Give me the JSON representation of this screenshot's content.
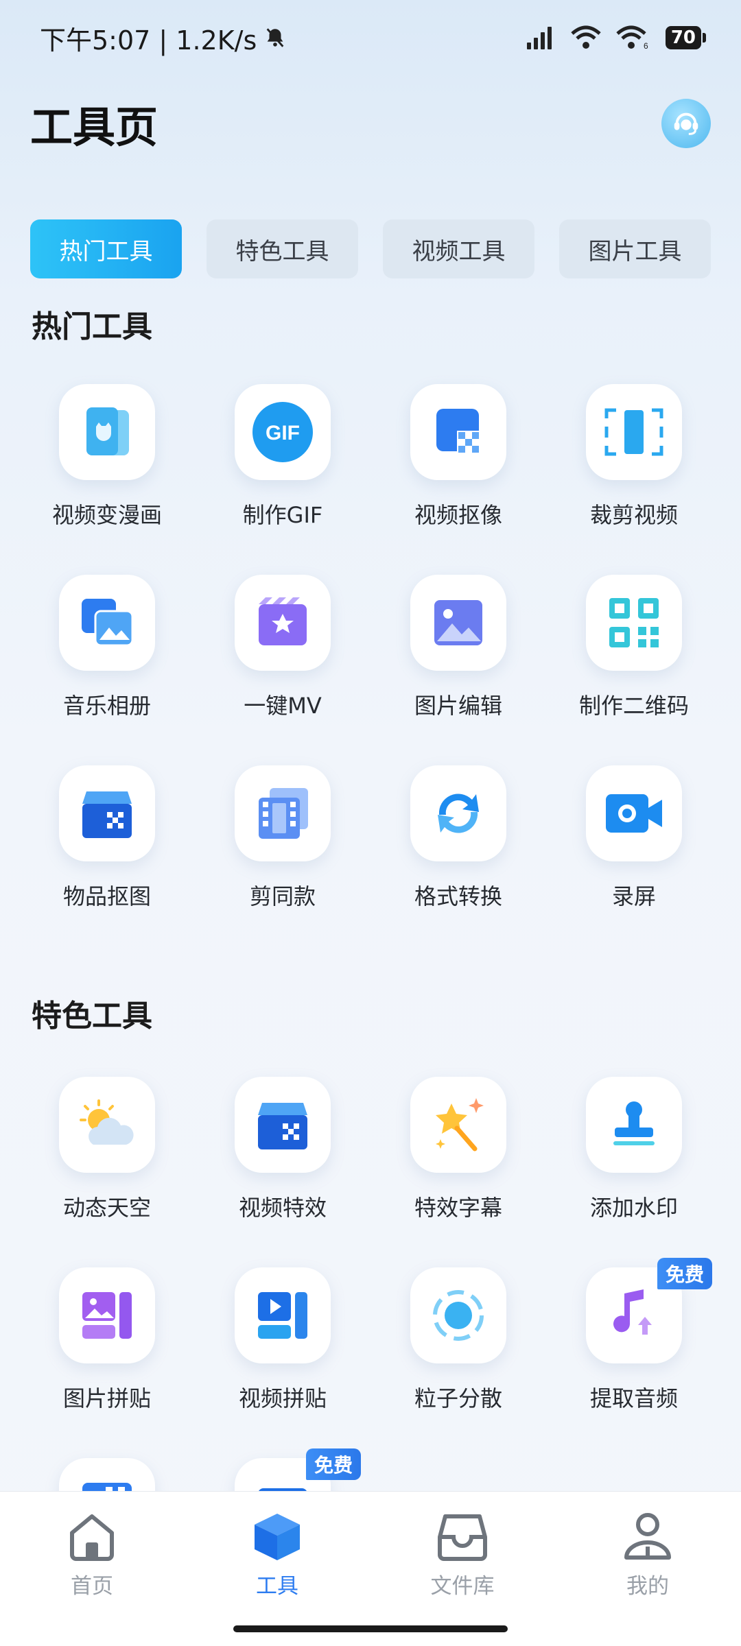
{
  "status": {
    "left_text": "下午5:07 | 1.2K/s",
    "battery": "70",
    "icons": [
      "mute-bell-icon",
      "signal-icon",
      "wifi-icon",
      "wifi6-icon"
    ]
  },
  "header": {
    "title": "工具页",
    "support_icon": "customer-service-icon"
  },
  "tabs": [
    {
      "label": "热门工具",
      "active": true
    },
    {
      "label": "特色工具",
      "active": false
    },
    {
      "label": "视频工具",
      "active": false
    },
    {
      "label": "图片工具",
      "active": false
    }
  ],
  "sections": [
    {
      "title": "热门工具",
      "tools": [
        {
          "label": "视频变漫画",
          "icon": "cartoon-video-icon"
        },
        {
          "label": "制作GIF",
          "icon": "gif-icon"
        },
        {
          "label": "视频抠像",
          "icon": "video-matting-icon"
        },
        {
          "label": "裁剪视频",
          "icon": "crop-video-icon"
        },
        {
          "label": "音乐相册",
          "icon": "music-album-icon"
        },
        {
          "label": "一键MV",
          "icon": "one-click-mv-icon"
        },
        {
          "label": "图片编辑",
          "icon": "image-edit-icon"
        },
        {
          "label": "制作二维码",
          "icon": "qr-code-icon"
        },
        {
          "label": "物品抠图",
          "icon": "object-cutout-icon"
        },
        {
          "label": "剪同款",
          "icon": "template-film-icon"
        },
        {
          "label": "格式转换",
          "icon": "format-convert-icon"
        },
        {
          "label": "录屏",
          "icon": "screen-record-icon"
        }
      ]
    },
    {
      "title": "特色工具",
      "tools": [
        {
          "label": "动态天空",
          "icon": "dynamic-sky-icon"
        },
        {
          "label": "视频特效",
          "icon": "video-effects-icon"
        },
        {
          "label": "特效字幕",
          "icon": "effect-subtitle-icon"
        },
        {
          "label": "添加水印",
          "icon": "watermark-stamp-icon"
        },
        {
          "label": "图片拼贴",
          "icon": "image-collage-icon"
        },
        {
          "label": "视频拼贴",
          "icon": "video-collage-icon"
        },
        {
          "label": "粒子分散",
          "icon": "particle-scatter-icon"
        },
        {
          "label": "提取音频",
          "icon": "extract-audio-icon",
          "badge": "免费"
        }
      ]
    }
  ],
  "partial_tools": [
    {
      "icon": "partial-tool-icon"
    },
    {
      "icon": "partial-tool-icon",
      "badge": "免费"
    }
  ],
  "nav": [
    {
      "label": "首页",
      "icon": "home-icon",
      "active": false
    },
    {
      "label": "工具",
      "icon": "cube-icon",
      "active": true
    },
    {
      "label": "文件库",
      "icon": "inbox-icon",
      "active": false
    },
    {
      "label": "我的",
      "icon": "user-icon",
      "active": false
    }
  ]
}
